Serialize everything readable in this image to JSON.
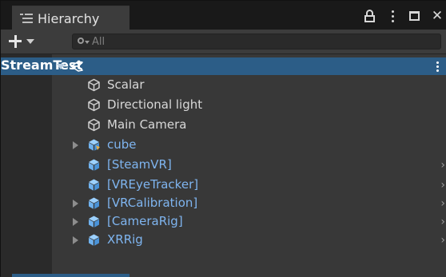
{
  "panel": {
    "title": "Hierarchy",
    "search_placeholder": "All"
  },
  "tree": {
    "scene": "StreamTest",
    "items": [
      {
        "label": "Scalar",
        "type": "gameobject",
        "fold": "none"
      },
      {
        "label": "Directional light",
        "type": "gameobject",
        "fold": "none"
      },
      {
        "label": "Main Camera",
        "type": "gameobject",
        "fold": "none"
      },
      {
        "label": "cube",
        "type": "prefab-variant",
        "fold": "closed"
      },
      {
        "label": "[SteamVR]",
        "type": "prefab",
        "fold": "none"
      },
      {
        "label": "[VREyeTracker]",
        "type": "prefab",
        "fold": "none"
      },
      {
        "label": "[VRCalibration]",
        "type": "prefab",
        "fold": "closed"
      },
      {
        "label": "[CameraRig]",
        "type": "prefab",
        "fold": "closed"
      },
      {
        "label": "XRRig",
        "type": "prefab",
        "fold": "closed"
      }
    ]
  },
  "colors": {
    "selection": "#2c5d87",
    "prefab_text": "#7fb5f0",
    "prefab_icon": "#6fb2ef",
    "background": "#383838"
  },
  "icons": {
    "tab": "hierarchy-list-icon",
    "lock": "lock-icon",
    "menu": "kebab-menu-icon",
    "maximize": "maximize-icon",
    "close": "close-icon",
    "add": "plus-icon",
    "search": "search-icon",
    "scene": "unity-scene-icon",
    "gameobject": "cube-outline-icon",
    "prefab": "prefab-cube-icon"
  }
}
